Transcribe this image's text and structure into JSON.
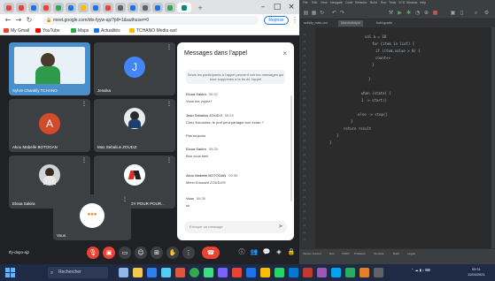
{
  "browser": {
    "url": "meet.google.com/dtx-fyyw-ajz?pli=1&authuser=0",
    "profile_label": "Reprise",
    "bookmarks": [
      "My Gmail",
      "YouTube",
      "Maps",
      "Actualités",
      "TCHANO Media sarl"
    ]
  },
  "participants": [
    {
      "name": "Sylvie Chantilly TCHANO",
      "initial": ""
    },
    {
      "name": "Jessika",
      "initial": "J"
    },
    {
      "name": "Akou Mabelle BOTOGAN",
      "initial": "A"
    },
    {
      "name": "Max Sebalius ZOUDJI",
      "initial": ""
    },
    {
      "name": "Eloua Sakira",
      "initial": ""
    },
    {
      "name": "YT-GROUP ENERGY POUR POUR...",
      "initial": ""
    },
    {
      "name": "Vous",
      "initial": ""
    }
  ],
  "chat": {
    "title": "Messages dans l'appel",
    "note": "Seuls les participants à l'appel peuvent voir les messages qui sont supprimés à la fin de l'appel",
    "messages": [
      {
        "author": "Eloua Sakira",
        "time": "09:22",
        "text": "Vous me voyez?"
      },
      {
        "author": "Jean Sebalius ZOUDJI",
        "time": "09:23",
        "text": "Chez Edourdes, le prof peut partager son écran ?"
      },
      {
        "author": "",
        "time": "",
        "text": "Pas toujours"
      },
      {
        "author": "Eloua Sakira",
        "time": "09:25",
        "text": "Bon vous bien"
      },
      {
        "author": "Akou Mabelle BOTOGAN",
        "time": "09:30",
        "text": "Merci Edouard ZOUDJI!!!"
      },
      {
        "author": "Vous",
        "time": "09:30",
        "text": "ok"
      }
    ],
    "input_placeholder": "Envoyer un message"
  },
  "meeting_code": "tfy-dxpo-ajz",
  "ide": {
    "menus": [
      "File",
      "Edit",
      "View",
      "Navigate",
      "Code",
      "Refactor",
      "Build",
      "Run",
      "Tools",
      "VCS",
      "Window",
      "Help"
    ],
    "tabs": [
      "activity_main.xml",
      "MainActivity.kt",
      "build.gradle"
    ],
    "code_lines": [
      "val a = 10",
      "for (item in list) {",
      "    if (item.value > 0) {",
      "        count++",
      "    }",
      "}",
      "when (state) {",
      "    1 -> start()",
      "    else -> stop()",
      "}",
      "return result",
      "}",
      "}"
    ],
    "status_items": [
      "Version Control",
      "Run",
      "TODO",
      "Problems",
      "Terminal",
      "Build",
      "Logcat"
    ]
  },
  "taskbar": {
    "search_placeholder": "Rechercher",
    "time": "09:31",
    "date": "11/03/2021"
  }
}
